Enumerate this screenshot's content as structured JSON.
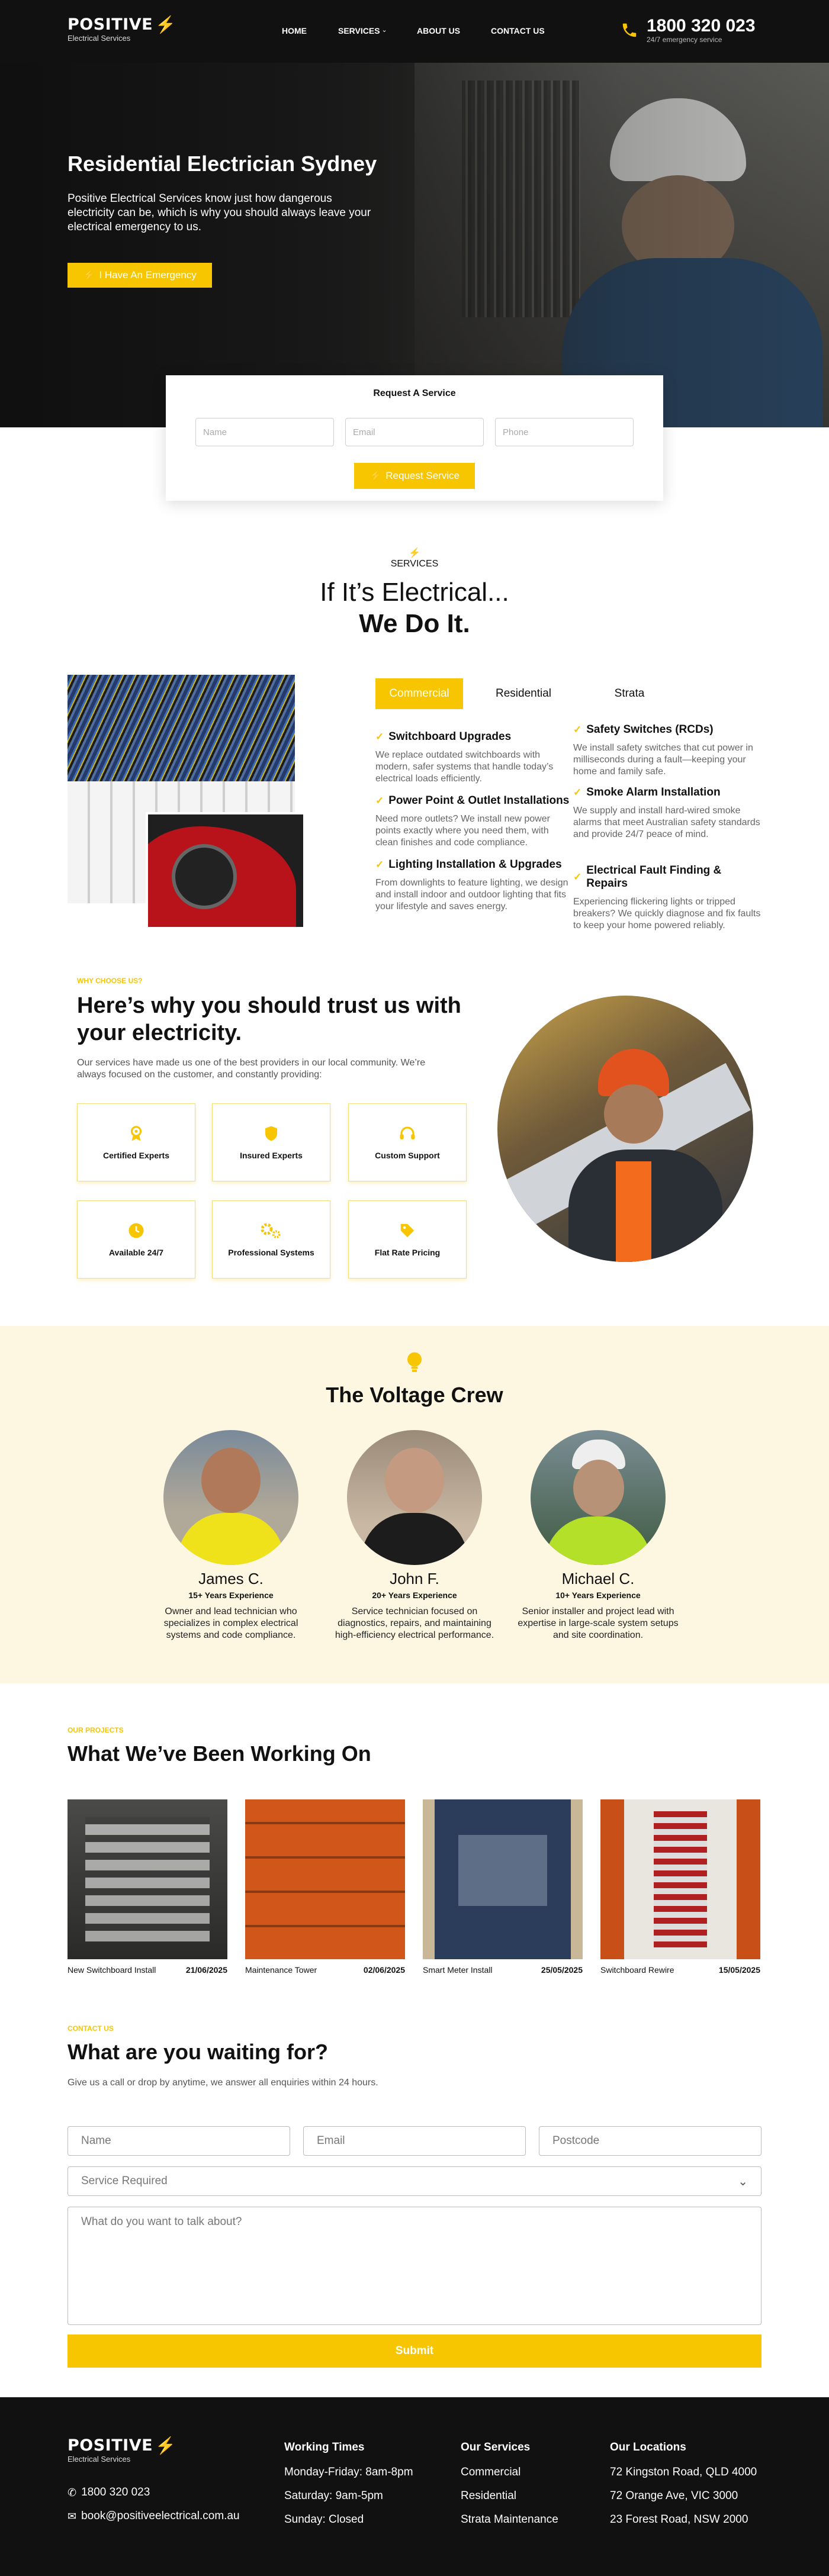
{
  "header": {
    "logo": "POSITIVE",
    "logo_sub": "Electrical Services",
    "nav": [
      "HOME",
      "SERVICES",
      "ABOUT US",
      "CONTACT US"
    ],
    "phone": "1800 320 023",
    "phone_sub": "24/7 emergency service"
  },
  "hero": {
    "title": "Residential Electrician Sydney",
    "text": "Positive Electrical Services know just how dangerous electricity can be, which is why you should always leave your electrical emergency to us.",
    "button": "I Have An Emergency"
  },
  "request": {
    "title": "Request A Service",
    "name_ph": "Name",
    "email_ph": "Email",
    "phone_ph": "Phone",
    "button": "Request Service"
  },
  "services": {
    "eyebrow": "SERVICES",
    "heading1": "If It’s Electrical...",
    "heading2": "We Do It.",
    "tabs": [
      "Commercial",
      "Residential",
      "Strata"
    ],
    "items": [
      {
        "title": "Switchboard Upgrades",
        "desc": "We replace outdated switchboards with modern, safer systems that handle today’s electrical loads efficiently."
      },
      {
        "title": "Safety Switches (RCDs)",
        "desc": "We install safety switches that cut power in milliseconds during a fault—keeping your home and family safe."
      },
      {
        "title": "Power Point & Outlet Installations",
        "desc": "Need more outlets? We install new power points exactly where you need them, with clean finishes and code compliance."
      },
      {
        "title": "Smoke Alarm Installation",
        "desc": "We supply and install hard-wired smoke alarms that meet Australian safety standards and provide 24/7 peace of mind."
      },
      {
        "title": "Lighting Installation & Upgrades",
        "desc": "From downlights to feature lighting, we design and install indoor and outdoor lighting that fits your lifestyle and saves energy."
      },
      {
        "title": "Electrical Fault Finding & Repairs",
        "desc": "Experiencing flickering lights or tripped breakers? We quickly diagnose and fix faults to keep your home powered reliably."
      }
    ]
  },
  "trust": {
    "eyebrow": "WHY CHOOSE US?",
    "heading": "Here’s why you should trust us with your electricity.",
    "text": "Our services have made us one of the best providers in our local community. We’re always focused on the customer, and constantly providing:",
    "boxes": [
      {
        "label": "Certified Experts",
        "icon": "award-icon"
      },
      {
        "label": "Insured Experts",
        "icon": "shield-icon"
      },
      {
        "label": "Custom Support",
        "icon": "headset-icon"
      },
      {
        "label": "Available 24/7",
        "icon": "clock-icon"
      },
      {
        "label": "Professional Systems",
        "icon": "gears-icon"
      },
      {
        "label": "Flat Rate Pricing",
        "icon": "tag-icon"
      }
    ]
  },
  "crew": {
    "heading": "The Voltage Crew",
    "members": [
      {
        "name": "James C.",
        "exp": "15+ Years Experience",
        "desc": "Owner and lead technician who specializes in complex electrical systems and code compliance."
      },
      {
        "name": "John F.",
        "exp": "20+ Years Experience",
        "desc": "Service technician focused on diagnostics, repairs, and maintaining high-efficiency electrical performance."
      },
      {
        "name": "Michael C.",
        "exp": "10+ Years Experience",
        "desc": "Senior installer and project lead with expertise in large-scale system setups and site coordination."
      }
    ]
  },
  "projects": {
    "eyebrow": "OUR PROJECTS",
    "heading": "What We’ve Been Working On",
    "items": [
      {
        "caption": "New Switchboard Install",
        "date": "21/06/2025"
      },
      {
        "caption": "Maintenance Tower",
        "date": "02/06/2025"
      },
      {
        "caption": "Smart Meter Install",
        "date": "25/05/2025"
      },
      {
        "caption": "Switchboard Rewire",
        "date": "15/05/2025"
      }
    ]
  },
  "contact": {
    "eyebrow": "CONTACT US",
    "heading": "What are you waiting for?",
    "text": "Give us a call or drop by anytime, we answer all enquiries within 24 hours.",
    "name_ph": "Name",
    "email_ph": "Email",
    "postcode_ph": "Postcode",
    "service_ph": "Service Required",
    "message_ph": "What do you want to talk about?",
    "submit": "Submit"
  },
  "footer": {
    "logo": "POSITIVE",
    "logo_sub": "Electrical Services",
    "phone": "1800 320 023",
    "email": "book@positiveelectrical.com.au",
    "hours_title": "Working Times",
    "hours": [
      "Monday-Friday: 8am-8pm",
      "Saturday: 9am-5pm",
      "Sunday: Closed"
    ],
    "services_title": "Our Services",
    "services": [
      "Commercial",
      "Residential",
      "Strata Maintenance"
    ],
    "locations_title": "Our Locations",
    "locations": [
      "72 Kingston Road, QLD 4000",
      "72 Orange Ave, VIC 3000",
      "23 Forest Road, NSW 2000"
    ]
  },
  "colors": {
    "accent": "#f7c600",
    "dark": "#111111",
    "cream": "#fdf7e2"
  }
}
